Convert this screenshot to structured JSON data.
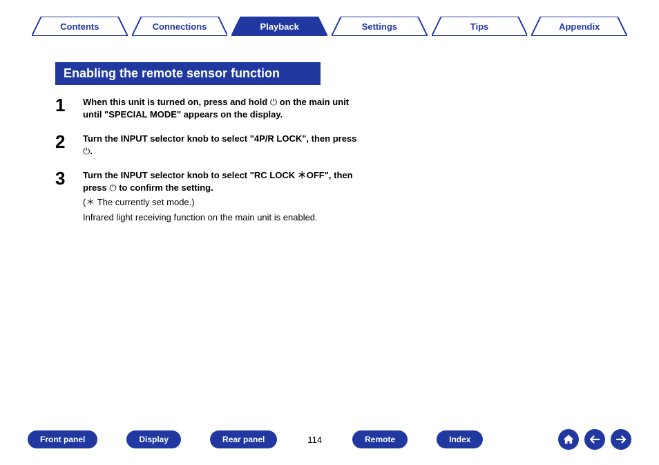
{
  "tabs": [
    {
      "label": "Contents",
      "active": false
    },
    {
      "label": "Connections",
      "active": false
    },
    {
      "label": "Playback",
      "active": true
    },
    {
      "label": "Settings",
      "active": false
    },
    {
      "label": "Tips",
      "active": false
    },
    {
      "label": "Appendix",
      "active": false
    }
  ],
  "section_title": "Enabling the remote sensor function",
  "steps": [
    {
      "num": "1",
      "bold_before": "When this unit is turned on, press and hold ",
      "power_inline": "⏻",
      "bold_after": " on the main unit until \"SPECIAL MODE\" appears on the display."
    },
    {
      "num": "2",
      "bold_before": "Turn the INPUT selector knob to select \"4P/R LOCK\", then press ",
      "power_inline": "⏻",
      "bold_after": "."
    },
    {
      "num": "3",
      "bold_before": "Turn the INPUT selector knob to select \"RC LOCK ＊OFF\", then press ",
      "power_inline": "⏻",
      "bold_after": " to confirm the setting.",
      "note1": "(＊ The currently set mode.)",
      "note2": "Infrared light receiving function on the main unit is enabled."
    }
  ],
  "bottom_links": [
    "Front panel",
    "Display",
    "Rear panel"
  ],
  "page_number": "114",
  "bottom_links_after": [
    "Remote",
    "Index"
  ],
  "nav_buttons": {
    "home": "home-icon",
    "prev": "arrow-left-icon",
    "next": "arrow-right-icon"
  },
  "colors": {
    "brand": "#2038a0"
  }
}
